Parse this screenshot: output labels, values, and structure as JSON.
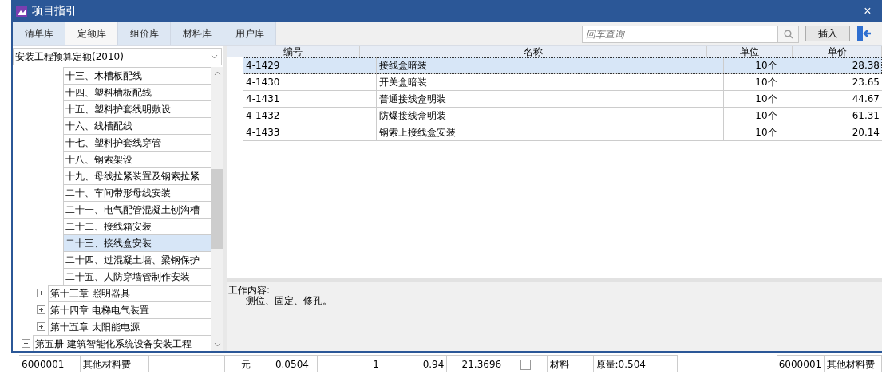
{
  "window": {
    "title": "项目指引",
    "close": "×"
  },
  "tabs": [
    {
      "label": "清单库",
      "selected": false
    },
    {
      "label": "定额库",
      "selected": true
    },
    {
      "label": "组价库",
      "selected": false
    },
    {
      "label": "材料库",
      "selected": false
    },
    {
      "label": "用户库",
      "selected": false
    }
  ],
  "search": {
    "placeholder": "回车查询"
  },
  "insert_button": "插入",
  "library_select": {
    "value": "安装工程预算定额(2010)"
  },
  "tree": [
    {
      "children": [
        {
          "children": [
            {
              "label": "十三、木槽板配线",
              "selected": false
            },
            {
              "label": "十四、塑料槽板配线",
              "selected": false
            },
            {
              "label": "十五、塑料护套线明敷设",
              "selected": false
            },
            {
              "label": "十六、线槽配线",
              "selected": false
            },
            {
              "label": "十七、塑料护套线穿管",
              "selected": false
            },
            {
              "label": "十八、钢索架设",
              "selected": false
            },
            {
              "label": "十九、母线拉紧装置及钢索拉紧",
              "selected": false
            },
            {
              "label": "二十、车间带形母线安装",
              "selected": false
            },
            {
              "label": "二十一、电气配管混凝土刨沟槽",
              "selected": false
            },
            {
              "label": "二十二、接线箱安装",
              "selected": false
            },
            {
              "label": "二十三、接线盒安装",
              "selected": true
            },
            {
              "label": "二十四、过混凝土墙、梁钢保护",
              "selected": false
            },
            {
              "label": "二十五、人防穿墙管制作安装",
              "selected": false
            }
          ]
        },
        {
          "label": "第十三章 照明器具",
          "expanded": false,
          "selected": false
        },
        {
          "label": "第十四章 电梯电气装置",
          "expanded": false,
          "selected": false
        },
        {
          "label": "第十五章 太阳能电源",
          "expanded": false,
          "selected": false
        }
      ]
    },
    {
      "label": "第五册 建筑智能化系统设备安装工程",
      "expanded": false,
      "selected": false
    }
  ],
  "table": {
    "columns": [
      "编号",
      "名称",
      "单位",
      "单价"
    ],
    "rows": [
      {
        "cells": [
          "4-1429",
          "接线盒暗装",
          "10个",
          "28.38"
        ],
        "selected": true
      },
      {
        "cells": [
          "4-1430",
          "开关盒暗装",
          "10个",
          "23.65"
        ],
        "selected": false
      },
      {
        "cells": [
          "4-1431",
          "普通接线盒明装",
          "10个",
          "44.67"
        ],
        "selected": false
      },
      {
        "cells": [
          "4-1432",
          "防爆接线盒明装",
          "10个",
          "61.31"
        ],
        "selected": false
      },
      {
        "cells": [
          "4-1433",
          "钢索上接线盒安装",
          "10个",
          "20.14"
        ],
        "selected": false
      }
    ]
  },
  "work_content": {
    "label": "工作内容:",
    "text": "测位、固定、修孔。"
  },
  "background_row": {
    "cells": [
      "6000001",
      "其他材料费",
      "",
      "元",
      "0.0504",
      "1",
      "0.94",
      "21.3696"
    ],
    "checked": false,
    "after": [
      "材料",
      "原量:0.504"
    ],
    "right_cells": [
      "6000001",
      "其他材料费"
    ]
  }
}
